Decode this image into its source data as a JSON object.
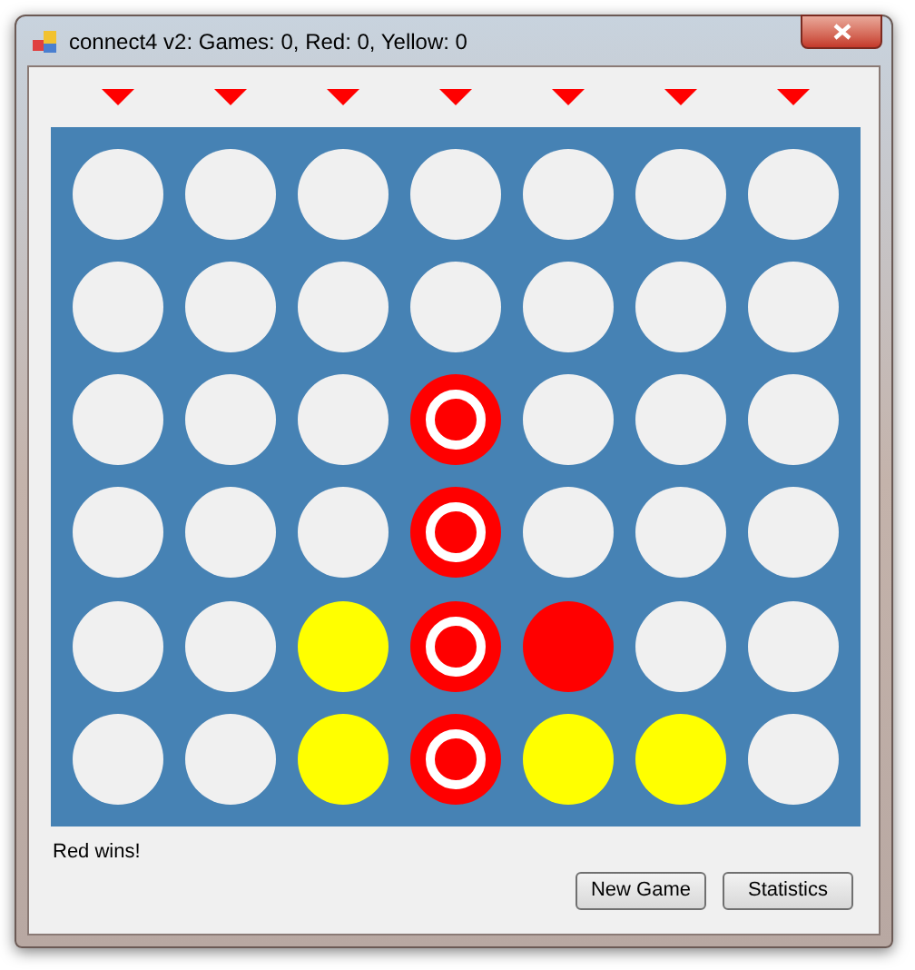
{
  "window": {
    "title": "connect4 v2: Games: 0, Red: 0, Yellow: 0"
  },
  "board": [
    [
      {
        "color": "#f0f0f0",
        "winning": false
      },
      {
        "color": "#f0f0f0",
        "winning": false
      },
      {
        "color": "#f0f0f0",
        "winning": false
      },
      {
        "color": "#f0f0f0",
        "winning": false
      },
      {
        "color": "#f0f0f0",
        "winning": false
      },
      {
        "color": "#f0f0f0",
        "winning": false
      },
      {
        "color": "#f0f0f0",
        "winning": false
      }
    ],
    [
      {
        "color": "#f0f0f0",
        "winning": false
      },
      {
        "color": "#f0f0f0",
        "winning": false
      },
      {
        "color": "#f0f0f0",
        "winning": false
      },
      {
        "color": "#f0f0f0",
        "winning": false
      },
      {
        "color": "#f0f0f0",
        "winning": false
      },
      {
        "color": "#f0f0f0",
        "winning": false
      },
      {
        "color": "#f0f0f0",
        "winning": false
      }
    ],
    [
      {
        "color": "#f0f0f0",
        "winning": false
      },
      {
        "color": "#f0f0f0",
        "winning": false
      },
      {
        "color": "#f0f0f0",
        "winning": false
      },
      {
        "color": "#ff0000",
        "winning": true
      },
      {
        "color": "#f0f0f0",
        "winning": false
      },
      {
        "color": "#f0f0f0",
        "winning": false
      },
      {
        "color": "#f0f0f0",
        "winning": false
      }
    ],
    [
      {
        "color": "#f0f0f0",
        "winning": false
      },
      {
        "color": "#f0f0f0",
        "winning": false
      },
      {
        "color": "#f0f0f0",
        "winning": false
      },
      {
        "color": "#ff0000",
        "winning": true
      },
      {
        "color": "#f0f0f0",
        "winning": false
      },
      {
        "color": "#f0f0f0",
        "winning": false
      },
      {
        "color": "#f0f0f0",
        "winning": false
      }
    ],
    [
      {
        "color": "#f0f0f0",
        "winning": false
      },
      {
        "color": "#f0f0f0",
        "winning": false
      },
      {
        "color": "#ffff00",
        "winning": false
      },
      {
        "color": "#ff0000",
        "winning": true
      },
      {
        "color": "#ff0000",
        "winning": false
      },
      {
        "color": "#f0f0f0",
        "winning": false
      },
      {
        "color": "#f0f0f0",
        "winning": false
      }
    ],
    [
      {
        "color": "#f0f0f0",
        "winning": false
      },
      {
        "color": "#f0f0f0",
        "winning": false
      },
      {
        "color": "#ffff00",
        "winning": false
      },
      {
        "color": "#ff0000",
        "winning": true
      },
      {
        "color": "#ffff00",
        "winning": false
      },
      {
        "color": "#ffff00",
        "winning": false
      },
      {
        "color": "#f0f0f0",
        "winning": false
      }
    ]
  ],
  "status": "Red wins!",
  "buttons": [
    "New Game",
    "Statistics"
  ]
}
